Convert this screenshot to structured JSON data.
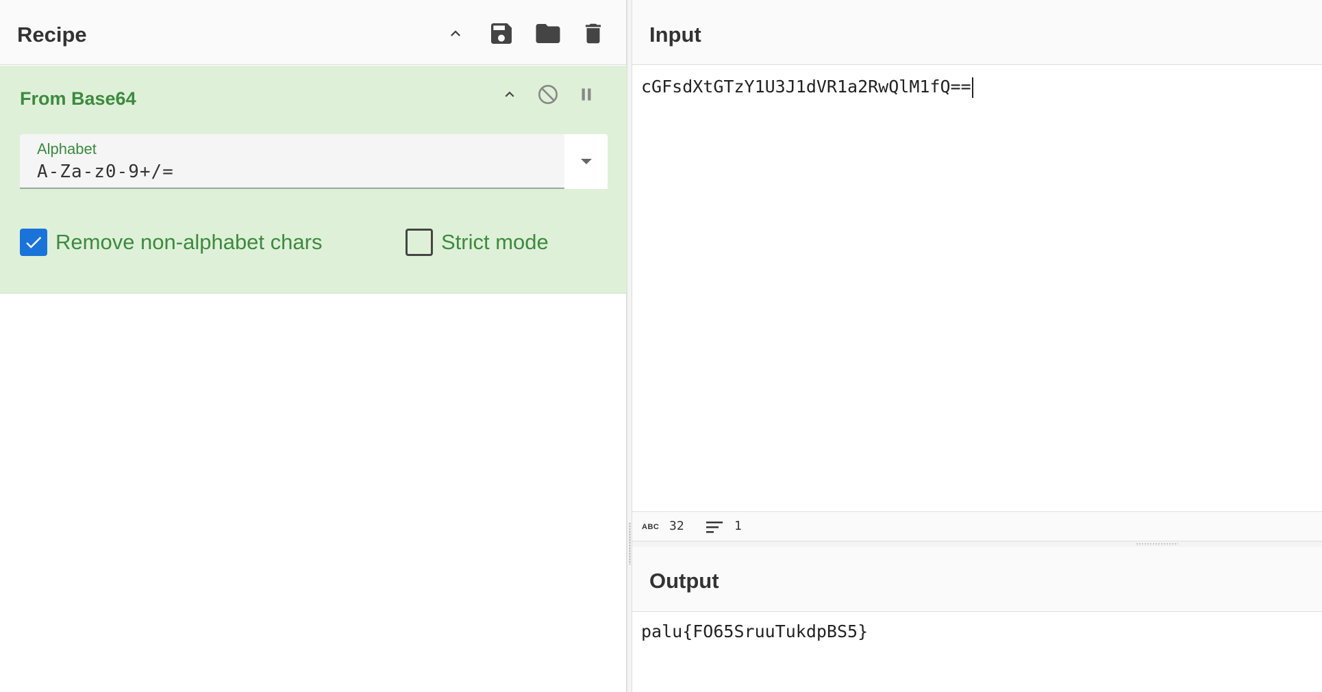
{
  "recipe": {
    "title": "Recipe",
    "operation": {
      "name": "From Base64",
      "alphabet": {
        "label": "Alphabet",
        "value": "A-Za-z0-9+/="
      },
      "remove_non_alphabet": {
        "label": "Remove non-alphabet chars",
        "checked": true
      },
      "strict_mode": {
        "label": "Strict mode",
        "checked": false
      }
    },
    "icons": [
      "chevron-up-icon",
      "save-icon",
      "folder-icon",
      "trash-icon",
      "disable-icon",
      "pause-icon"
    ]
  },
  "input": {
    "title": "Input",
    "text": "cGFsdXtGTzY1U3J1dVR1a2RwQlM1fQ==",
    "status": {
      "abc_label": "ABC",
      "length": "32",
      "lines": "1"
    }
  },
  "output": {
    "title": "Output",
    "text": "palu{FO65SruuTukdpBS5}"
  },
  "colors": {
    "accent_green": "#3c8a3f",
    "op_background": "#dff0d8",
    "checkbox_blue": "#1a73d9"
  }
}
